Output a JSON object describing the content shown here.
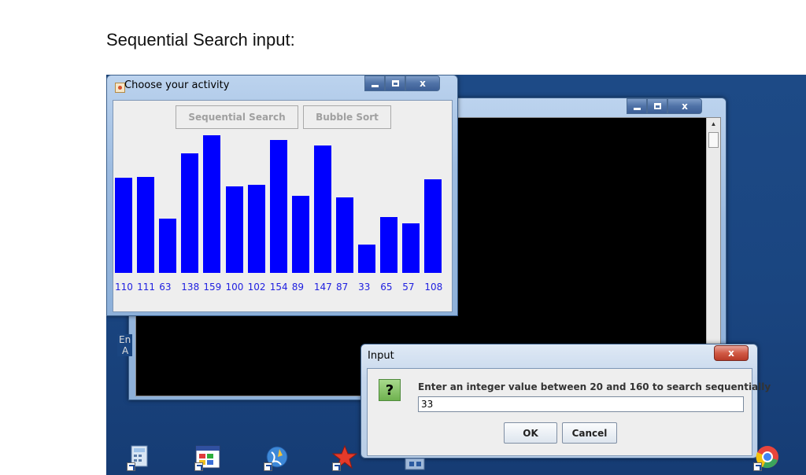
{
  "heading": "Sequential Search input:",
  "activity_window": {
    "title": "Choose your activity",
    "buttons": {
      "sequential_search": "Sequential Search",
      "bubble_sort": "Bubble Sort"
    },
    "bar_color": "#0000ff",
    "values": [
      110,
      111,
      63,
      138,
      159,
      100,
      102,
      154,
      89,
      147,
      87,
      33,
      65,
      57,
      108
    ]
  },
  "caption_buttons": {
    "close": "x"
  },
  "console_window": {
    "text_lines": [
      "En",
      "A"
    ]
  },
  "input_dialog": {
    "title": "Input",
    "icon": "?",
    "prompt": "Enter an integer value between 20 and 160 to search sequentially",
    "value": "33",
    "ok_label": "OK",
    "cancel_label": "Cancel",
    "close_label": "x"
  },
  "desktop_icons": [
    "calculator-icon",
    "paint-icon",
    "globe-icon",
    "star-icon",
    "network-icon",
    "chrome-icon"
  ],
  "colors": {
    "desktop": "#1a4580",
    "console": "#000000",
    "close_button": "#d15a45"
  }
}
